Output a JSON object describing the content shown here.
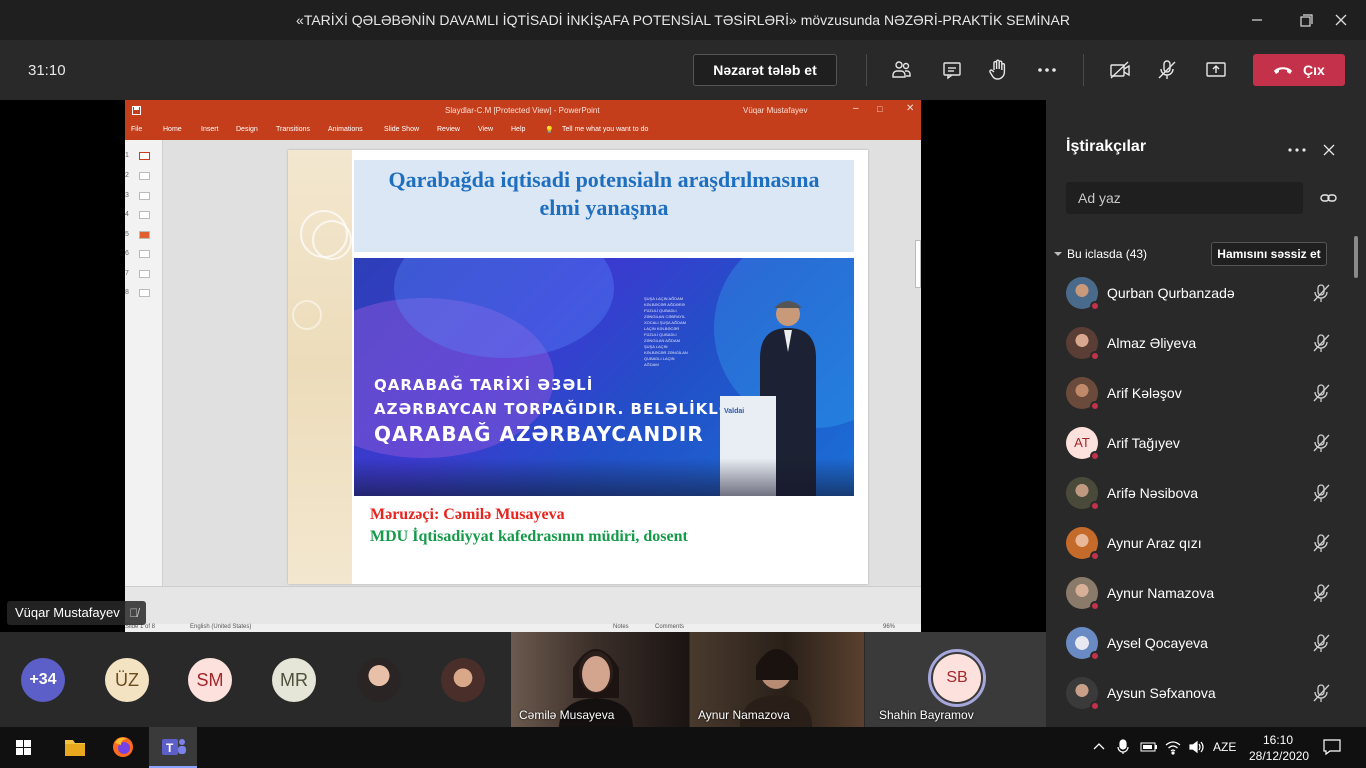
{
  "window": {
    "title": "«TARİXİ QƏLƏBƏNİN DAVAMLI İQTİSADİ İNKİŞAFA POTENSİAL TƏSİRLƏRİ» mövzusunda NƏZƏRİ-PRAKTİK SEMİNAR"
  },
  "toolbar": {
    "timer": "31:10",
    "control_label": "Nəzarət tələb et",
    "leave_label": "Çıx",
    "icons": [
      "participants-icon",
      "chat-icon",
      "raise-hand-icon",
      "more-icon",
      "camera-off-icon",
      "mic-off-icon",
      "share-icon",
      "hang-up-icon"
    ],
    "leave_color": "#c4314b"
  },
  "presentation": {
    "presenter": "Vüqar Mustafayev",
    "ppt_title": "Slaydlar-C.M [Protected View] - PowerPoint",
    "ppt_user": "Vüqar Mustafayev",
    "ribbon": [
      "File",
      "Home",
      "Insert",
      "Design",
      "Transitions",
      "Animations",
      "Slide Show",
      "Review",
      "View",
      "Help",
      "Tell me what you want to do"
    ],
    "slide_numbers": [
      "1",
      "2",
      "3",
      "4",
      "5",
      "6",
      "7",
      "8"
    ],
    "status_slide": "Slide 1 of 8",
    "status_lang": "English (United States)",
    "status_notes": "Notes",
    "status_comments": "Comments",
    "status_zoom": "96%",
    "slide": {
      "heading_line1": "Qarabağda iqtisadi potensialn araşdrılmasına",
      "heading_line2": "elmi yanaşma",
      "banner_line1": "QARABAĞ TARİXİ Ə3ƏLİ",
      "banner_line2": "AZƏRBAYCAN TORPAĞIDIR. BELƏLİKLƏ,",
      "banner_line3": "QARABAĞ AZƏRBAYCANDIR",
      "podium_logo": "Valdai",
      "speaker": "Məruzəçi: Cəmilə Musayeva",
      "role": "MDU İqtisadiyyat kafedrasının müdiri, dosent",
      "heading_color": "#1f6fc0",
      "speaker_color": "#e8231e",
      "role_color": "#159a4a"
    }
  },
  "gallery": {
    "overflow": "+34",
    "initials": [
      {
        "text": "ÜZ",
        "bg": "#f4e3c3",
        "fg": "#6b4e1f"
      },
      {
        "text": "SM",
        "bg": "#fde1dc",
        "fg": "#a4262c"
      },
      {
        "text": "MR",
        "bg": "#e6e6d8",
        "fg": "#4f4f3c"
      }
    ],
    "videos": [
      {
        "name": "Cəmilə Musayeva"
      },
      {
        "name": "Aynur Namazova"
      },
      {
        "name": "Shahin Bayramov",
        "initials": "SB"
      }
    ]
  },
  "panel": {
    "title": "İştirakçılar",
    "search_placeholder": "Ad yaz",
    "section_label": "Bu iclasda (43)",
    "mute_all_label": "Hamısını səssiz et",
    "participants": [
      {
        "name": "Qurban Qurbanzadə",
        "kind": "photo",
        "color": "#4a6a8c"
      },
      {
        "name": "Almaz Əliyeva",
        "kind": "photo",
        "color": "#5a3d35"
      },
      {
        "name": "Arif Kələşov",
        "kind": "photo",
        "color": "#6a4a3a"
      },
      {
        "name": "Arif Tağıyev",
        "kind": "initials",
        "initials": "AT",
        "color": "#fde1dc"
      },
      {
        "name": "Arifə Nəsibova",
        "kind": "photo",
        "color": "#4a4a3a"
      },
      {
        "name": "Aynur Araz qızı",
        "kind": "photo",
        "color": "#c46a2a"
      },
      {
        "name": "Aynur Namazova",
        "kind": "photo",
        "color": "#8a7a6a"
      },
      {
        "name": "Aysel Qocayeva",
        "kind": "photo",
        "color": "#6a8ac4"
      },
      {
        "name": "Aysun Səfxanova",
        "kind": "photo",
        "color": "#3a3a3a"
      }
    ]
  },
  "taskbar": {
    "lang": "AZE",
    "time": "16:10",
    "date": "28/12/2020"
  }
}
